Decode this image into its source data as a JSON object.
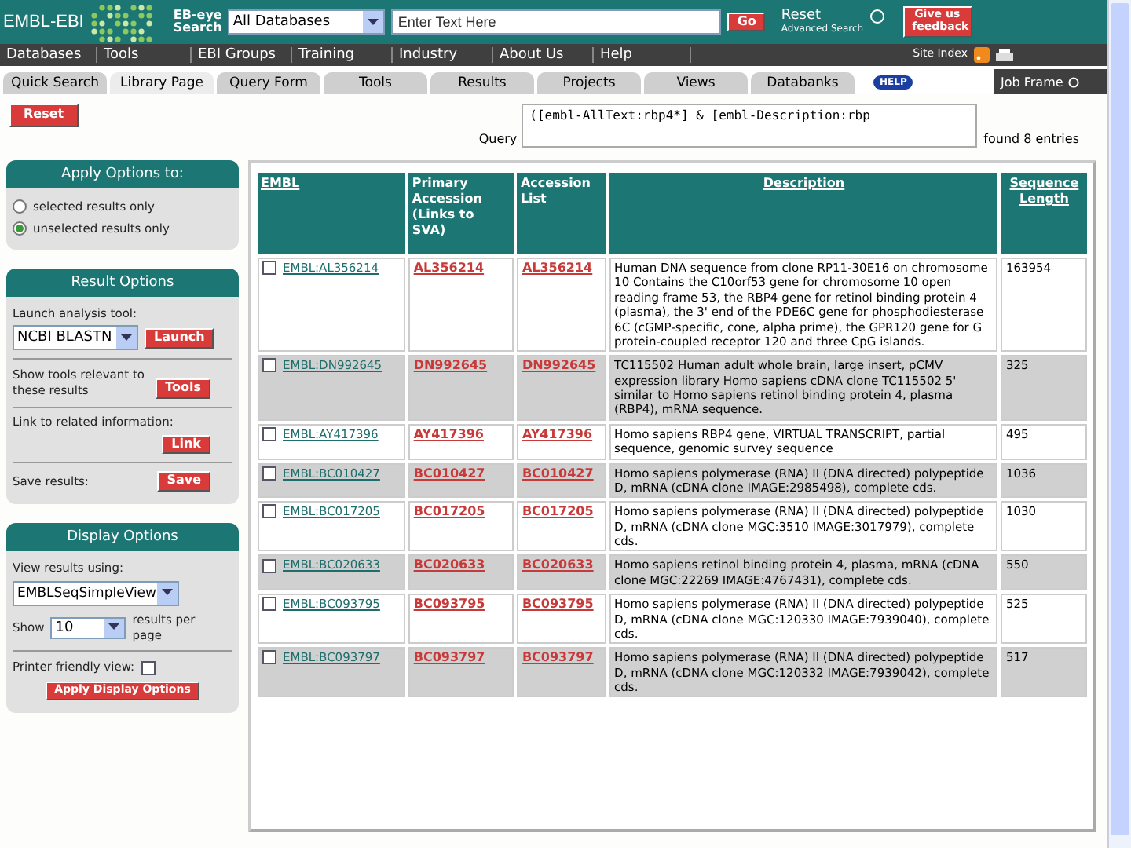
{
  "header": {
    "logo": "EMBL-EBI",
    "search_label": "EB-eye Search",
    "database_select": "All Databases",
    "search_field": {
      "placeholder": "Enter Text Here"
    },
    "go_button": "Go",
    "reset_link": "Reset",
    "advanced_link": "Advanced Search",
    "feedback_button": "Give us feedback"
  },
  "menu": [
    "Databases",
    "Tools",
    "EBI Groups",
    "Training",
    "Industry",
    "About Us",
    "Help"
  ],
  "site_index": "Site Index",
  "tabs": [
    {
      "label": "Quick Search",
      "selected": false
    },
    {
      "label": "Library Page",
      "selected": true
    },
    {
      "label": "Query Form",
      "selected": false
    },
    {
      "label": "Tools",
      "selected": false
    },
    {
      "label": "Results",
      "selected": false
    },
    {
      "label": "Projects",
      "selected": false
    },
    {
      "label": "Views",
      "selected": false
    },
    {
      "label": "Databanks",
      "selected": false
    }
  ],
  "help_badge": "HELP",
  "job_frame": "Job Frame",
  "reset_button": "Reset",
  "query_label": "Query",
  "query": "([embl-AllText:rbp4*] & [embl-Description:rbp",
  "found": "found 8 entries",
  "apply_options": {
    "title": "Apply Options to:",
    "options": [
      {
        "label": "selected results only",
        "selected": false
      },
      {
        "label": "unselected results only",
        "selected": true
      }
    ]
  },
  "result_options": {
    "title": "Result Options",
    "launch_label": "Launch analysis tool:",
    "tool_select": "NCBI BLASTN",
    "launch_button": "Launch",
    "tools_label": "Show tools relevant to these results",
    "tools_button": "Tools",
    "link_label": "Link to related information:",
    "link_button": "Link",
    "save_label": "Save results:",
    "save_button": "Save"
  },
  "display_options": {
    "title": "Display Options",
    "view_label": "View results using:",
    "view_select": "EMBLSeqSimpleView",
    "show_label": "Show",
    "show_select": "10",
    "per_page_label": "results per page",
    "printer_label": "Printer friendly view:",
    "printer_checked": false,
    "apply_button": "Apply Display Options"
  },
  "table": {
    "columns": [
      "EMBL",
      "Primary Accession (Links to SVA)",
      "Accession List",
      "Description",
      "Sequence Length"
    ],
    "rows": [
      {
        "checked": false,
        "entry": "EMBL:AL356214",
        "primary": "AL356214",
        "accession": "AL356214",
        "description": "Human DNA sequence from clone RP11-30E16 on chromosome 10 Contains the C10orf53 gene for chromosome 10 open reading frame 53, the RBP4 gene for retinol binding protein 4 (plasma), the 3' end of the PDE6C gene for phosphodiesterase 6C (cGMP-specific, cone, alpha prime), the GPR120 gene for G protein-coupled receptor 120 and three CpG islands.",
        "length": "163954"
      },
      {
        "checked": false,
        "entry": "EMBL:DN992645",
        "primary": "DN992645",
        "accession": "DN992645",
        "description": "TC115502 Human adult whole brain, large insert, pCMV expression library Homo sapiens cDNA clone TC115502 5' similar to Homo sapiens retinol binding protein 4, plasma (RBP4), mRNA sequence.",
        "length": "325"
      },
      {
        "checked": false,
        "entry": "EMBL:AY417396",
        "primary": "AY417396",
        "accession": "AY417396",
        "description": "Homo sapiens RBP4 gene, VIRTUAL TRANSCRIPT, partial sequence, genomic survey sequence",
        "length": "495"
      },
      {
        "checked": false,
        "entry": "EMBL:BC010427",
        "primary": "BC010427",
        "accession": "BC010427",
        "description": "Homo sapiens polymerase (RNA) II (DNA directed) polypeptide D, mRNA (cDNA clone IMAGE:2985498), complete cds.",
        "length": "1036"
      },
      {
        "checked": false,
        "entry": "EMBL:BC017205",
        "primary": "BC017205",
        "accession": "BC017205",
        "description": "Homo sapiens polymerase (RNA) II (DNA directed) polypeptide D, mRNA (cDNA clone MGC:3510 IMAGE:3017979), complete cds.",
        "length": "1030"
      },
      {
        "checked": false,
        "entry": "EMBL:BC020633",
        "primary": "BC020633",
        "accession": "BC020633",
        "description": "Homo sapiens retinol binding protein 4, plasma, mRNA (cDNA clone MGC:22269 IMAGE:4767431), complete cds.",
        "length": "550"
      },
      {
        "checked": false,
        "entry": "EMBL:BC093795",
        "primary": "BC093795",
        "accession": "BC093795",
        "description": "Homo sapiens polymerase (RNA) II (DNA directed) polypeptide D, mRNA (cDNA clone MGC:120330 IMAGE:7939040), complete cds.",
        "length": "525"
      },
      {
        "checked": false,
        "entry": "EMBL:BC093797",
        "primary": "BC093797",
        "accession": "BC093797",
        "description": "Homo sapiens polymerase (RNA) II (DNA directed) polypeptide D, mRNA (cDNA clone MGC:120332 IMAGE:7939042), complete cds.",
        "length": "517"
      }
    ]
  }
}
